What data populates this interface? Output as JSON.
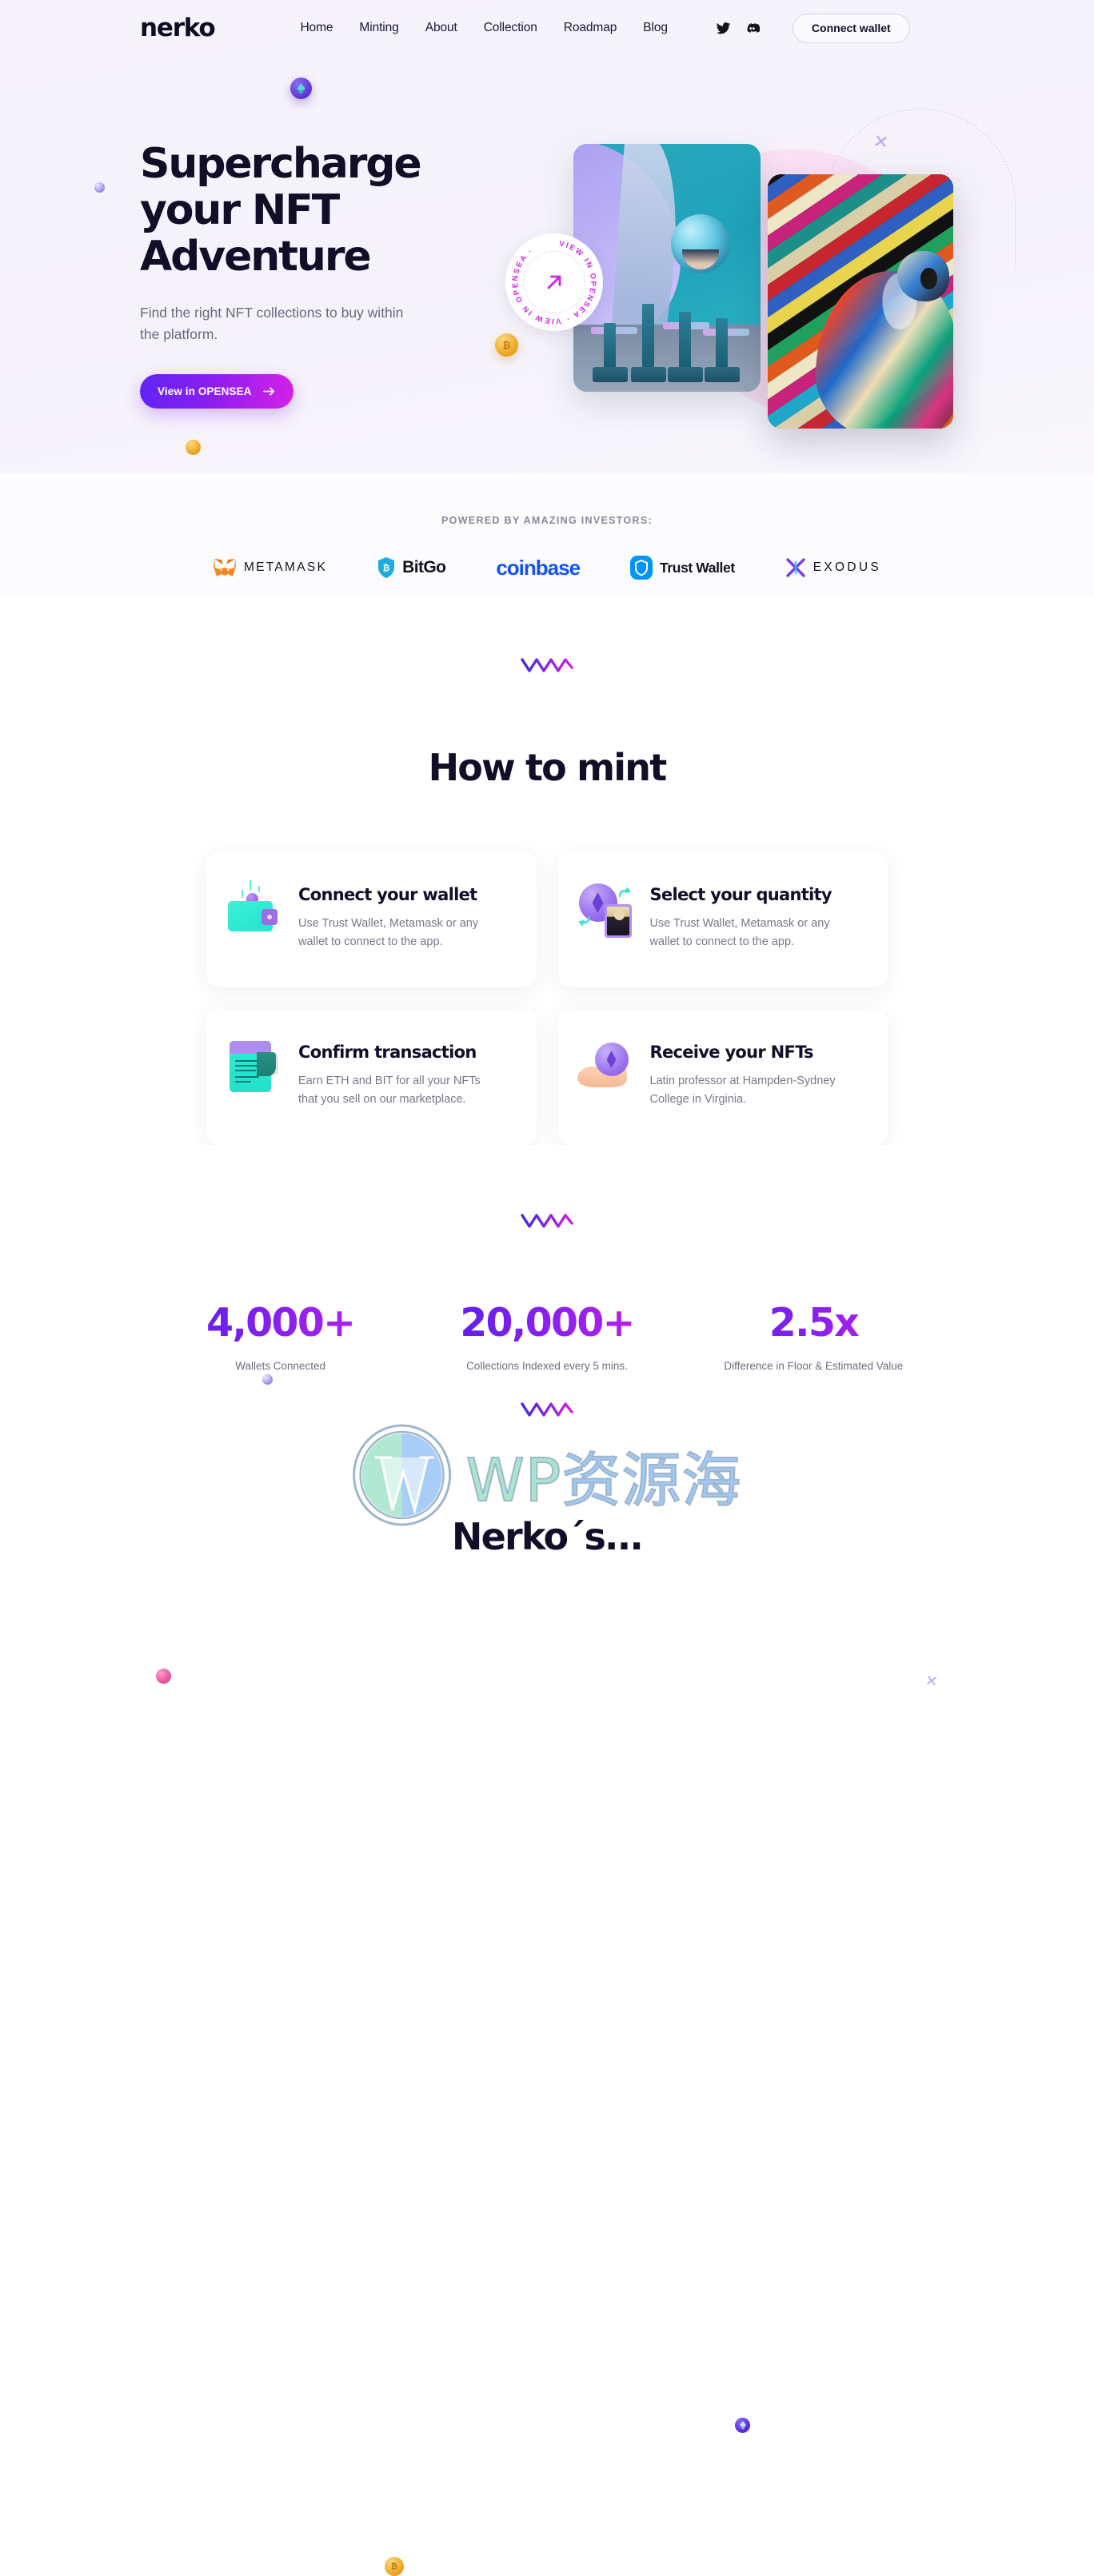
{
  "nav": {
    "logo": "nerko",
    "links": [
      "Home",
      "Minting",
      "About",
      "Collection",
      "Roadmap",
      "Blog"
    ],
    "socials": [
      {
        "name": "twitter-icon",
        "label": "Twitter"
      },
      {
        "name": "discord-icon",
        "label": "Discord"
      }
    ],
    "connect_label": "Connect wallet"
  },
  "hero": {
    "title_line1": "Supercharge",
    "title_line2": "your NFT",
    "title_line3": "Adventure",
    "subtitle": "Find the right NFT collections to buy within the platform.",
    "cta_label": "View in OPENSEA",
    "badge_text": "VIEW IN OPENSEA · VIEW IN OPENSEA ·",
    "bg_color": "#f6f3fb",
    "cta_gradient_from": "#6025f5",
    "cta_gradient_to": "#d421e8"
  },
  "investors": {
    "label": "POWERED BY AMAZING INVESTORS:",
    "logos": [
      {
        "name": "MetaMask",
        "display": "METAMASK",
        "color": "#f5841f"
      },
      {
        "name": "BitGo",
        "display": "BitGo",
        "color": "#1cabe2"
      },
      {
        "name": "Coinbase",
        "display": "coinbase",
        "color": "#1652f0"
      },
      {
        "name": "Trust Wallet",
        "display": "Trust Wallet",
        "color": "#0094f7"
      },
      {
        "name": "Exodus",
        "display": "EXODUS",
        "color": "#8b5cf6"
      }
    ]
  },
  "mint": {
    "heading": "How to mint",
    "cards": [
      {
        "icon": "wallet-icon",
        "title": "Connect your wallet",
        "text": "Use Trust Wallet, Metamask or any wallet to connect to the app."
      },
      {
        "icon": "eth-swap-icon",
        "title": "Select your quantity",
        "text": "Use Trust Wallet, Metamask or any wallet to connect to the app."
      },
      {
        "icon": "document-icon",
        "title": "Confirm transaction",
        "text": "Earn ETH and BIT for all your NFTs that you sell on our marketplace."
      },
      {
        "icon": "hand-coin-icon",
        "title": "Receive your NFTs",
        "text": "Latin professor at Hampden-Sydney College in Virginia."
      }
    ]
  },
  "stats": [
    {
      "value": "4,000+",
      "label": "Wallets Connected"
    },
    {
      "value": "20,000+",
      "label": "Collections Indexed every 5 mins."
    },
    {
      "value": "2.5x",
      "label": "Difference in Floor & Estimated Value"
    }
  ],
  "bottom": {
    "heading": "Nerko´s..."
  },
  "watermark": {
    "wp": "WP",
    "cn": "资源海"
  }
}
